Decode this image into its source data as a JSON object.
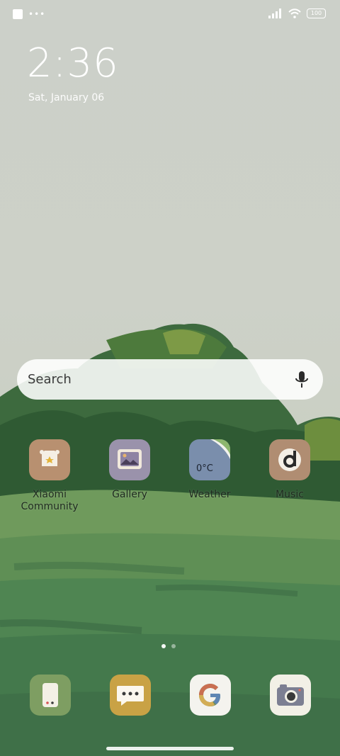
{
  "status_bar": {
    "battery_level": "100",
    "left_icons": [
      "notification-square-icon",
      "more-dots-icon"
    ],
    "right_icons": [
      "signal-icon",
      "wifi-icon",
      "battery-icon"
    ]
  },
  "lockscreen_clock": {
    "time": "2:36",
    "date": "Sat, January 06"
  },
  "search": {
    "label": "Search",
    "icon": "mic-icon"
  },
  "apps": [
    {
      "label": "Xiaomi Community",
      "icon": "xiaomi-community-icon",
      "color": "#b89070"
    },
    {
      "label": "Gallery",
      "icon": "gallery-icon",
      "color": "#9a92ab"
    },
    {
      "label": "Weather",
      "icon": "weather-icon",
      "color": "#7a8eac",
      "badge": "0°C"
    },
    {
      "label": "Music",
      "icon": "music-icon",
      "color": "#b08d72"
    }
  ],
  "dock": [
    {
      "icon": "phone-app-icon",
      "color": "#7e9e62"
    },
    {
      "icon": "messages-icon",
      "color": "#c9a245"
    },
    {
      "icon": "google-icon",
      "color": "#f4f3ee"
    },
    {
      "icon": "camera-icon",
      "color": "#f2f0e6"
    }
  ],
  "pages": {
    "count": 2,
    "current": 1
  }
}
